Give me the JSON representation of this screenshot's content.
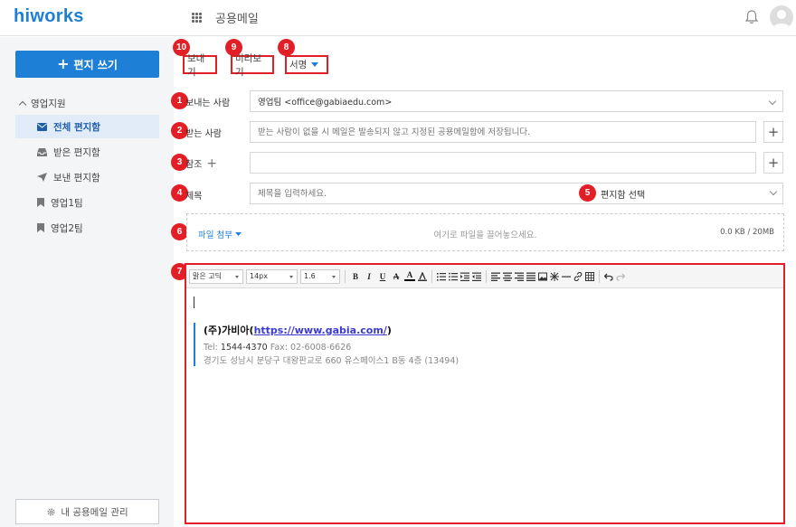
{
  "header": {
    "logo": "hiworks",
    "app_title": "공용메일"
  },
  "sidebar": {
    "write_label": "편지 쓰기",
    "group_label": "영업지원",
    "items": [
      {
        "label": "전체 편지함",
        "icon": "mail-icon",
        "active": true
      },
      {
        "label": "받은 편지함",
        "icon": "inbox-icon",
        "active": false
      },
      {
        "label": "보낸 편지함",
        "icon": "send-icon",
        "active": false
      },
      {
        "label": "영업1팀",
        "icon": "bookmark-icon",
        "active": false
      },
      {
        "label": "영업2팀",
        "icon": "bookmark-icon",
        "active": false
      }
    ],
    "manage_label": "내 공용메일 관리"
  },
  "toolbar": {
    "send": "보내기",
    "preview": "미리보기",
    "signature": "서명"
  },
  "badges": [
    "1",
    "2",
    "3",
    "4",
    "5",
    "6",
    "7",
    "8",
    "9",
    "10"
  ],
  "form": {
    "sender_label": "보내는 사람",
    "sender_value": "영업팀 <office@gabiaedu.com>",
    "to_label": "받는 사람",
    "to_placeholder": "받는 사람이 없을 시 메일은 발송되지 않고 지정된 공용메일함에 저장됩니다.",
    "cc_label": "참조",
    "subject_label": "제목",
    "subject_placeholder": "제목을 입력하세요.",
    "folder_select": "편지함 선택"
  },
  "attachment": {
    "label": "파일 첨부",
    "hint": "여기로 파일을 끌어놓으세요.",
    "size": "0.0 KB / 20MB"
  },
  "editor": {
    "font": "맑은 고딕",
    "size": "14px",
    "line_height": "1.6",
    "signature": {
      "company": "(주)가비아(",
      "url": "https://www.gabia.com/",
      "company_close": ")",
      "tel_label": "Tel:",
      "tel": "1544-4370",
      "fax_label": "Fax:",
      "fax": "02-6008-6626",
      "address": "경기도 성남시 분당구 대왕판교로 660 유스페이스1 B동 4층 (13494)"
    }
  },
  "colors": {
    "accent": "#1e7fd6",
    "highlight": "#e21f26"
  }
}
